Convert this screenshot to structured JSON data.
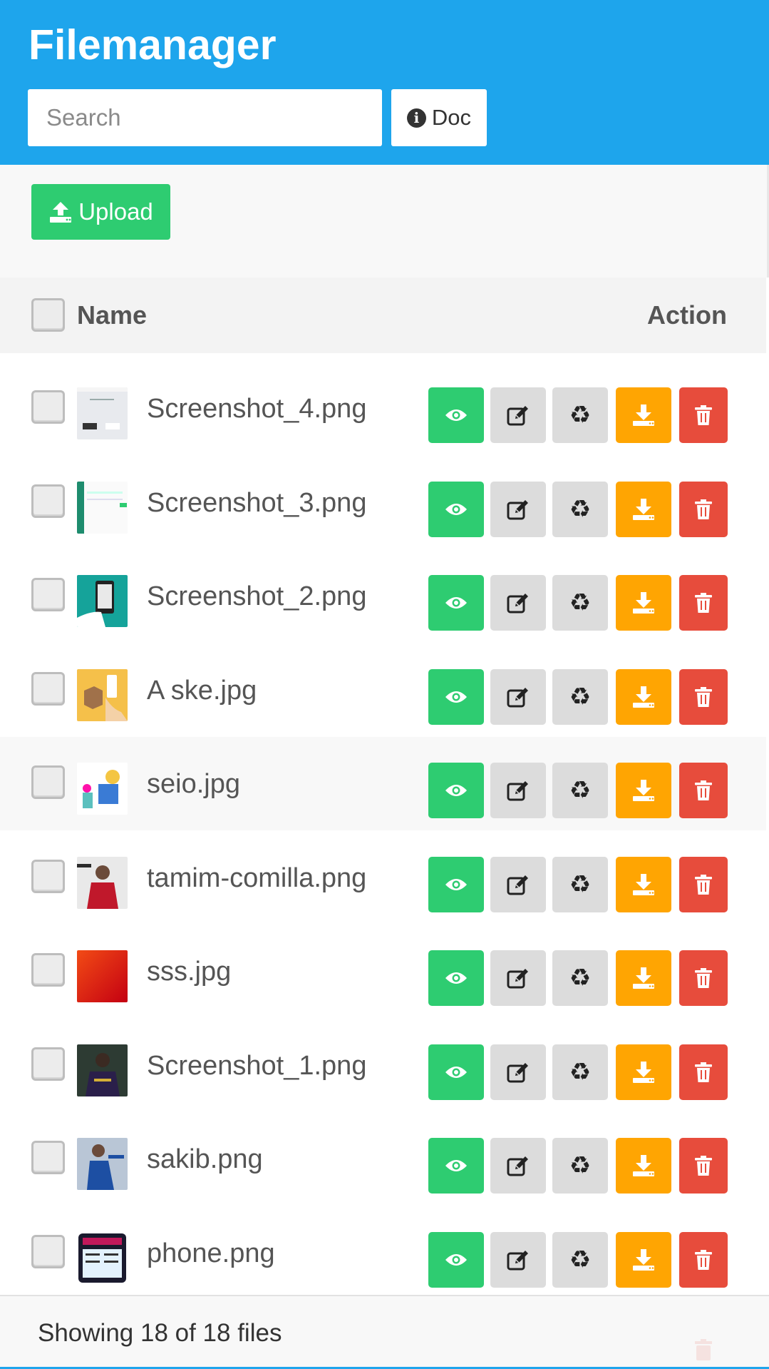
{
  "app": {
    "title": "Filemanager"
  },
  "search": {
    "placeholder": "Search",
    "value": ""
  },
  "header": {
    "doc_label": "Doc"
  },
  "toolbar": {
    "upload_label": "Upload"
  },
  "table": {
    "columns": [
      "Name",
      "Action"
    ],
    "rows": [
      {
        "name": "Screenshot_4.png",
        "thumb": "screenshot-app"
      },
      {
        "name": "Screenshot_3.png",
        "thumb": "screenshot-green"
      },
      {
        "name": "Screenshot_2.png",
        "thumb": "phone-hand"
      },
      {
        "name": "A ske.jpg",
        "thumb": "box-phone"
      },
      {
        "name": "seio.jpg",
        "thumb": "illustration",
        "highlighted": true
      },
      {
        "name": "tamim-comilla.png",
        "thumb": "cricketer-red"
      },
      {
        "name": "sss.jpg",
        "thumb": "red-gradient"
      },
      {
        "name": "Screenshot_1.png",
        "thumb": "cricketer-dark"
      },
      {
        "name": "sakib.png",
        "thumb": "cricketer-blue"
      },
      {
        "name": "phone.png",
        "thumb": "phone-screen"
      }
    ],
    "actions": [
      "view-icon",
      "edit-icon",
      "recycle-icon",
      "download-icon",
      "trash-icon"
    ]
  },
  "footer": {
    "status": "Showing 18 of 18 files"
  },
  "colors": {
    "header": "#1ea5ec",
    "view": "#2ecc71",
    "edit": "#dcdcdc",
    "download": "#ffa502",
    "delete": "#e74c3c"
  }
}
